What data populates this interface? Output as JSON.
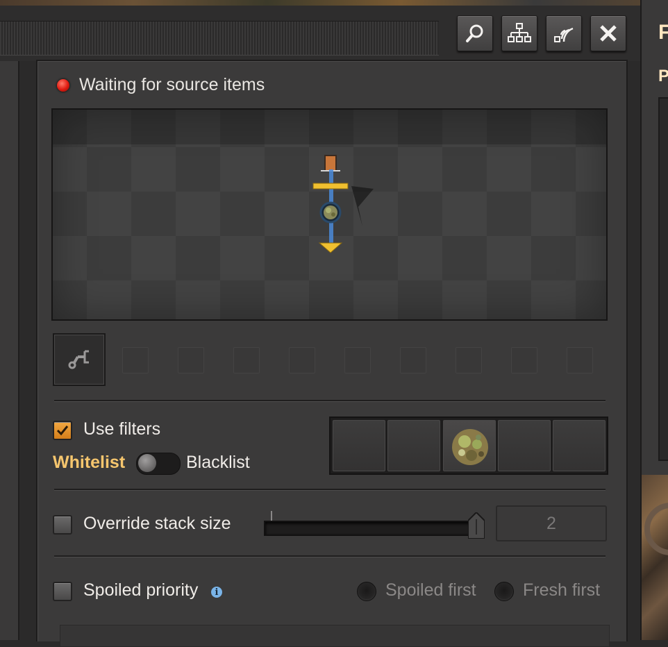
{
  "window": {
    "title_partial": "F",
    "subtitle_partial": "P",
    "toolbar": {
      "search_icon": "search-icon",
      "network_icon": "network-icon",
      "signal_icon": "signal-icon",
      "close_icon": "close-icon"
    }
  },
  "status": {
    "text": "Waiting for source items",
    "color": "#e01a10"
  },
  "filters": {
    "use_filters_label": "Use filters",
    "use_filters_checked": true,
    "whitelist_label": "Whitelist",
    "blacklist_label": "Blacklist",
    "mode": "whitelist",
    "slots": [
      "",
      "",
      "spoiled-item",
      "",
      ""
    ]
  },
  "stack_size": {
    "label": "Override stack size",
    "checked": false,
    "value": "2"
  },
  "spoiled_priority": {
    "label": "Spoiled priority",
    "checked": false,
    "options": [
      "Spoiled first",
      "Fresh first"
    ]
  },
  "colors": {
    "accent_orange": "#f2a842",
    "whitelist_text": "#f6c66e",
    "panel_bg": "#3b3a3a"
  }
}
